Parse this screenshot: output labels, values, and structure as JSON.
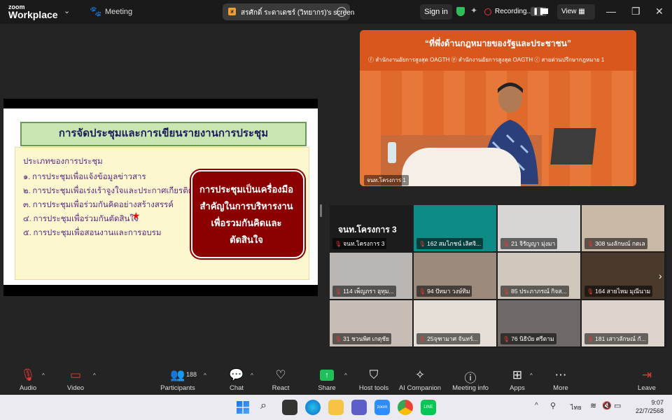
{
  "titlebar": {
    "logo_top": "zoom",
    "logo_bottom": "Workplace",
    "meeting_label": "Meeting",
    "share_tab_label": "สรศักดิ์ ระดาเดชร์ (วิทยากร)'s screen",
    "signin_label": "Sign in",
    "recording_label": "Recording...",
    "view_label": "View"
  },
  "slide": {
    "title": "การจัดประชุมและการเขียนรายงานการประชุม",
    "heading": "ประเภทของการประชุม",
    "items": [
      "๑. การประชุมเพื่อแจ้งข้อมูลข่าวสาร",
      "๒. การประชุมเพื่อเร่งเร้าจูงใจและประกาศเกียรติคุณ",
      "๓. การประชุมเพื่อร่วมกันคิดอย่างสร้างสรรค์",
      "๔. การประชุมเพื่อร่วมกันตัดสินใจ",
      "๕. การประชุมเพื่อสอนงานและการอบรม"
    ],
    "box_lines": [
      "การประชุมเป็นเครื่องมือ",
      "สำคัญในการบริหารงาน",
      "เพื่อรวมกันคิดและ",
      "ตัดสินใจ"
    ]
  },
  "speaker": {
    "banner": "“ที่พึ่งด้านกฎหมายของรัฐและประชาชน”",
    "org_line": "ⓕ สำนักงานอัยการสูงสุด OAGTH  ⓟ สำนักงานอัยการสูงสุด OAGTH  ⓒ สายด่วนปรึกษากฎหมาย 1",
    "name": "จนท.โครงการ 1"
  },
  "gallery": {
    "big_name": "จนท.โครงการ 3",
    "tiles": [
      {
        "label": "จนท.โครงการ 3",
        "bg": "#1c1c1c"
      },
      {
        "label": "162 สมโภชน์ เลิศจิ...",
        "bg": "#0d8c87"
      },
      {
        "label": "21 จิรัญญา มุ่งมา",
        "bg": "#d8d6d4"
      },
      {
        "label": "308 นงลักษณ์ กตเล",
        "bg": "#c9b9a6"
      },
      {
        "label": "114 เพ็ญภรา อุทุม...",
        "bg": "#b9b6b3"
      },
      {
        "label": "94 ปัทมา วงษ์ทิม",
        "bg": "#9c8a7c"
      },
      {
        "label": "85 ประภาภรณ์ กิจส...",
        "bg": "#cfc6bc"
      },
      {
        "label": "164 สายไหม มุณีนาม",
        "bg": "#4a3a2c"
      },
      {
        "label": "31 ชวนพิศ เกตุชัย",
        "bg": "#c7bdb4"
      },
      {
        "label": "25จุฑามาศ จันทร์...",
        "bg": "#e6dfd8"
      },
      {
        "label": "76 นิธิบัย ศรีตาม",
        "bg": "#6f6a67"
      },
      {
        "label": "181 เสาวลักษณ์ กั...",
        "bg": "#ddd4cb"
      }
    ]
  },
  "toolbar": {
    "audio": "Audio",
    "video": "Video",
    "participants": "Participants",
    "participants_count": "188",
    "chat": "Chat",
    "react": "React",
    "share": "Share",
    "host_tools": "Host tools",
    "ai_companion": "AI Companion",
    "meeting_info": "Meeting info",
    "apps": "Apps",
    "more": "More",
    "leave": "Leave"
  },
  "taskbar": {
    "lang": "ไทย",
    "time": "9:07",
    "date": "22/7/2568"
  }
}
